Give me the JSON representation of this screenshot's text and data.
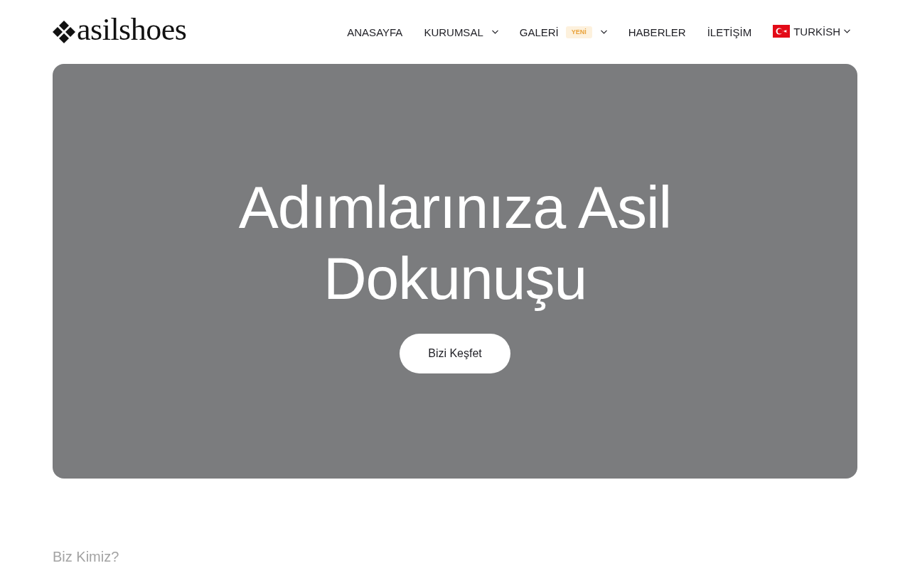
{
  "logo": {
    "text": "asilshoes"
  },
  "nav": {
    "items": [
      {
        "label": "ANASAYFA",
        "dropdown": false
      },
      {
        "label": "KURUMSAL",
        "dropdown": true
      },
      {
        "label": "GALERİ",
        "badge": "YENİ",
        "dropdown": true
      },
      {
        "label": "HABERLER",
        "dropdown": false
      },
      {
        "label": "İLETİŞİM",
        "dropdown": false
      }
    ],
    "language": {
      "label": "TURKİSH",
      "dropdown": true
    }
  },
  "hero": {
    "title": "Adımlarınıza Asil Dokunuşu",
    "button": "Bizi Keşfet"
  },
  "section": {
    "title": "Biz Kimiz?"
  }
}
